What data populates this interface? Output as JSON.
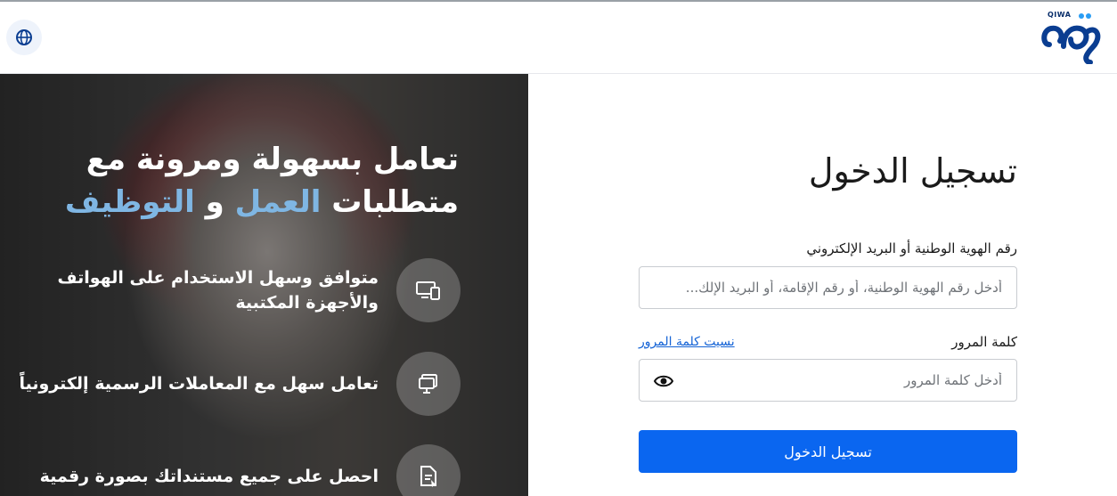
{
  "header": {
    "logo_small_text": "QIWA",
    "language_icon": "globe-icon"
  },
  "hero": {
    "title_line1": "تعامل بسهولة ومرونة مع",
    "title_line2_part1": "متطلبات ",
    "title_line2_highlight1": "العمل",
    "title_line2_part2": " و ",
    "title_line2_highlight2": "التوظيف",
    "highlight_color": "#7fb6e3",
    "features": [
      {
        "icon": "devices-icon",
        "line1": "متوافق وسهل الاستخدام على الهواتف",
        "line2": "والأجهزة المكتبية"
      },
      {
        "icon": "monitor-icon",
        "line1": "تعامل سهل مع المعاملات الرسمية إلكترونياً",
        "line2": ""
      },
      {
        "icon": "document-icon",
        "line1": "احصل على جميع مستنداتك بصورة رقمية",
        "line2": ""
      }
    ]
  },
  "login": {
    "title": "تسجيل الدخول",
    "id_label": "رقم الهوية الوطنية أو البريد الإلكتروني",
    "id_placeholder": "أدخل رقم الهوية الوطنية، أو رقم الإقامة، أو البريد الإلك...",
    "password_label": "كلمة المرور",
    "forgot_password": "نسيت كلمة المرور",
    "password_placeholder": "أدخل كلمة المرور",
    "submit_label": "تسجيل الدخول",
    "primary_color": "#0a66f0"
  }
}
